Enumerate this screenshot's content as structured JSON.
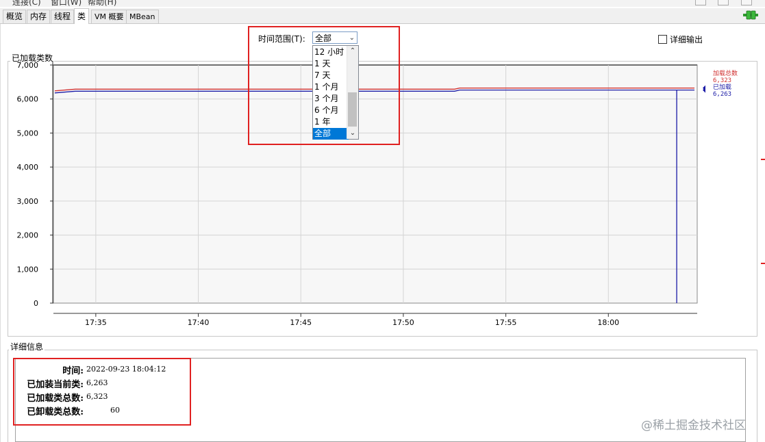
{
  "window_top_fragments": [
    "连接(C)",
    "窗口(W)",
    "帮助(H)"
  ],
  "tabs": [
    {
      "label": "概览"
    },
    {
      "label": "内存"
    },
    {
      "label": "线程"
    },
    {
      "label": "类"
    },
    {
      "label": "VM 概要"
    },
    {
      "label": "MBean"
    }
  ],
  "active_tab": "类",
  "time_range": {
    "label": "时间范围(T):",
    "selected": "全部",
    "options": [
      "12 小时",
      "1 天",
      "7 天",
      "1 个月",
      "3 个月",
      "6 个月",
      "1 年",
      "全部"
    ]
  },
  "verbose_output": {
    "label": "详细输出",
    "checked": false
  },
  "chart_panel_title": "已加载类数",
  "chart_data": {
    "type": "line",
    "x_ticks": [
      "17:35",
      "17:40",
      "17:45",
      "17:50",
      "17:55",
      "18:00"
    ],
    "y_ticks": [
      "7,000",
      "6,000",
      "5,000",
      "4,000",
      "3,000",
      "2,000",
      "1,000",
      "0"
    ],
    "ylim": [
      0,
      7000
    ],
    "series": [
      {
        "name": "加载总数",
        "value_label": "6,323",
        "color": "#d03030",
        "points": [
          [
            "17:33:00",
            6240
          ],
          [
            "17:34:00",
            6290
          ],
          [
            "17:52:30",
            6290
          ],
          [
            "17:52:45",
            6323
          ],
          [
            "18:04:12",
            6323
          ]
        ]
      },
      {
        "name": "已加载",
        "value_label": "6,263",
        "color": "#1a1aa6",
        "points": [
          [
            "17:33:00",
            6180
          ],
          [
            "17:34:00",
            6230
          ],
          [
            "17:52:30",
            6230
          ],
          [
            "17:52:45",
            6263
          ],
          [
            "18:03:20",
            6263
          ],
          [
            "18:03:20",
            0
          ],
          [
            "18:03:20",
            6263
          ],
          [
            "18:04:12",
            6263
          ]
        ]
      }
    ]
  },
  "details": {
    "title": "详细信息",
    "rows": [
      {
        "label": "时间:",
        "value": "2022-09-23 18:04:12"
      },
      {
        "label": "已加装当前类:",
        "value": "6,263"
      },
      {
        "label": "已加载类总数:",
        "value": "6,323"
      },
      {
        "label": "已卸载类总数:",
        "value": "60"
      }
    ]
  },
  "watermark": "@稀土掘金技术社区",
  "colors": {
    "highlight_box": "#e02020",
    "selected_option": "#0078d7",
    "accent_green": "#2e9a2e"
  }
}
